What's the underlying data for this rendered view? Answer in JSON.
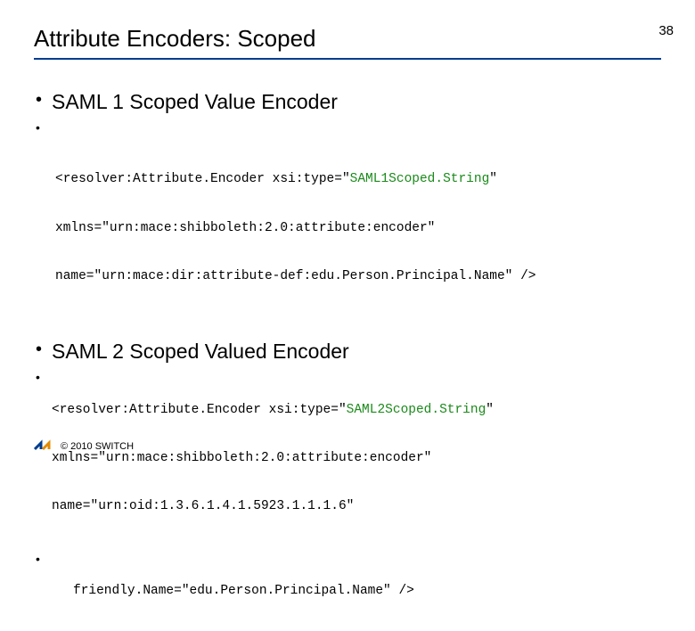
{
  "page_number": "38",
  "title": "Attribute Encoders: Scoped",
  "section1": {
    "heading": "SAML 1 Scoped Value Encoder",
    "code_l1a": "<resolver:Attribute.Encoder xsi:type=\"",
    "code_l1_type": "SAML1Scoped.String",
    "code_l1b": "\"",
    "code_l2": "xmlns=\"urn:mace:shibboleth:2.0:attribute:encoder\"",
    "code_l3": "name=\"urn:mace:dir:attribute-def:edu.Person.Principal.Name\" />"
  },
  "section2": {
    "heading": "SAML 2 Scoped Valued Encoder",
    "code_l1a": "<resolver:Attribute.Encoder xsi:type=\"",
    "code_l1_type": "SAML2Scoped.String",
    "code_l1b": "\"",
    "code_l2": "xmlns=\"urn:mace:shibboleth:2.0:attribute:encoder\"",
    "code_l3": "name=\"urn:oid:1.3.6.1.4.1.5923.1.1.1.6\"",
    "code_l4": "friendly.Name=\"edu.Person.Principal.Name\" />"
  },
  "footer": {
    "copyright": "© 2010 SWITCH"
  }
}
